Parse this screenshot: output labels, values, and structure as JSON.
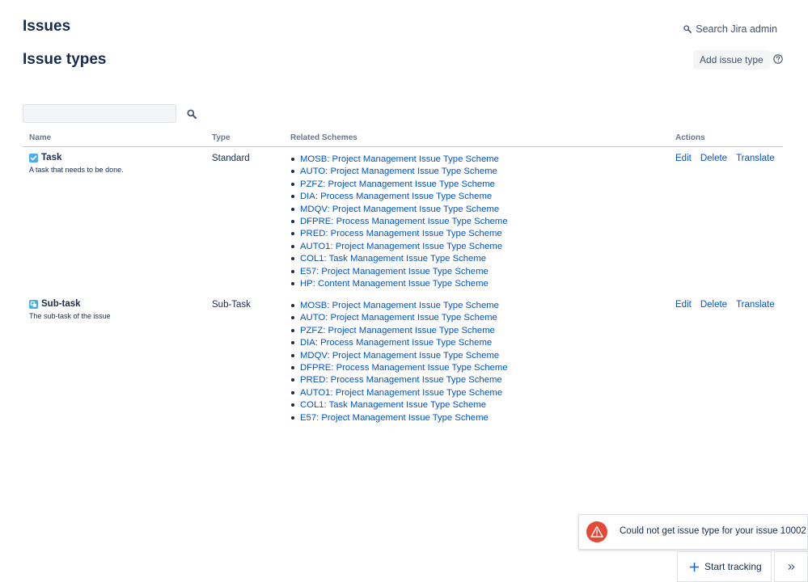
{
  "header": {
    "page_title": "Issues",
    "search_admin_label": "Search Jira admin"
  },
  "section": {
    "title": "Issue types",
    "add_button_label": "Add issue type"
  },
  "filter": {
    "value": "",
    "placeholder": ""
  },
  "table": {
    "columns": [
      "Name",
      "Type",
      "Related Schemes",
      "Actions"
    ],
    "rows": [
      {
        "name": "Task",
        "icon": "checkbox-task-icon",
        "description": "A task that needs to be done.",
        "type": "Standard",
        "schemes": [
          "MOSB: Project Management Issue Type Scheme",
          "AUTO: Project Management Issue Type Scheme",
          "PZFZ: Project Management Issue Type Scheme",
          "DIA: Process Management Issue Type Scheme",
          "MDQV: Project Management Issue Type Scheme",
          "DFPRE: Process Management Issue Type Scheme",
          "PRED: Process Management Issue Type Scheme",
          "AUTO1: Project Management Issue Type Scheme",
          "COL1: Task Management Issue Type Scheme",
          "E57: Project Management Issue Type Scheme",
          "HP: Content Management Issue Type Scheme"
        ],
        "actions": [
          "Edit",
          "Delete",
          "Translate"
        ]
      },
      {
        "name": "Sub-task",
        "icon": "subtask-icon",
        "description": "The sub-task of the issue",
        "type": "Sub-Task",
        "schemes": [
          "MOSB: Project Management Issue Type Scheme",
          "AUTO: Project Management Issue Type Scheme",
          "PZFZ: Project Management Issue Type Scheme",
          "DIA: Process Management Issue Type Scheme",
          "MDQV: Project Management Issue Type Scheme",
          "DFPRE: Process Management Issue Type Scheme",
          "PRED: Process Management Issue Type Scheme",
          "AUTO1: Project Management Issue Type Scheme",
          "COL1: Task Management Issue Type Scheme",
          "E57: Project Management Issue Type Scheme"
        ],
        "actions": [
          "Edit",
          "Delete",
          "Translate"
        ]
      }
    ]
  },
  "toast": {
    "message": "Could not get issue type for your issue 10002",
    "icon": "warning-icon",
    "color": "#e34935"
  },
  "tracking": {
    "label": "Start tracking",
    "icon": "plus-icon"
  },
  "colors": {
    "link": "#0052cc",
    "text": "#172b4d",
    "muted": "#6b778c",
    "issue_icon": "#4bade8"
  }
}
